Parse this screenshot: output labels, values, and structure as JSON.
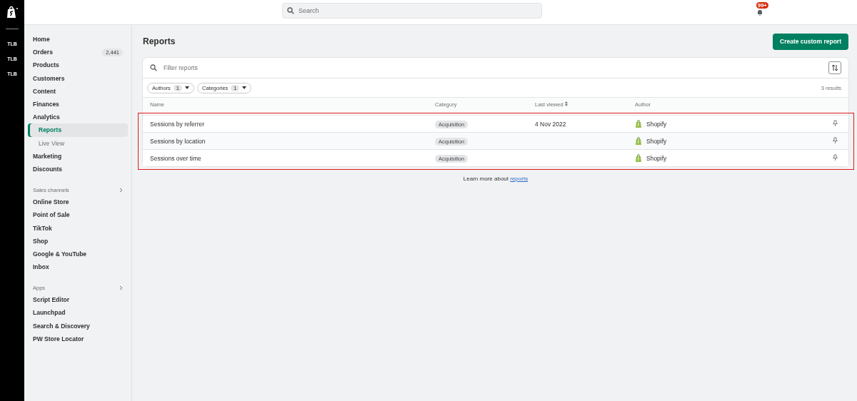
{
  "rail": {
    "items": [
      {
        "label": "TLB",
        "selected": false
      },
      {
        "label": "TLB",
        "selected": false
      },
      {
        "label": "TLB",
        "selected": false
      }
    ]
  },
  "top_bar": {
    "search": {
      "placeholder": "Search"
    },
    "notifications": {
      "badge": "99+"
    }
  },
  "sidebar": {
    "groups": [
      {
        "items": [
          {
            "label": "Home",
            "selected": false
          },
          {
            "label": "Orders",
            "badge": "2,441",
            "selected": false
          },
          {
            "label": "Products",
            "selected": false
          },
          {
            "label": "Customers",
            "selected": false
          },
          {
            "label": "Content",
            "selected": false
          },
          {
            "label": "Finances",
            "selected": false
          },
          {
            "label": "Analytics",
            "selected": false,
            "children": [
              {
                "label": "Reports",
                "selected": true
              },
              {
                "label": "Live View",
                "selected": false
              }
            ]
          },
          {
            "label": "Marketing",
            "selected": false
          },
          {
            "label": "Discounts",
            "selected": false
          }
        ]
      },
      {
        "heading": "Sales channels",
        "items": [
          {
            "label": "Online Store",
            "selected": false
          },
          {
            "label": "Point of Sale",
            "selected": false
          },
          {
            "label": "TikTok",
            "selected": false
          },
          {
            "label": "Shop",
            "selected": false
          },
          {
            "label": "Google & YouTube",
            "selected": false
          },
          {
            "label": "Inbox",
            "selected": false
          }
        ]
      },
      {
        "heading": "Apps",
        "items": [
          {
            "label": "Script Editor",
            "selected": false
          },
          {
            "label": "Launchpad",
            "selected": false
          },
          {
            "label": "Search & Discovery",
            "selected": false
          },
          {
            "label": "PW Store Locator",
            "selected": false
          }
        ]
      }
    ]
  },
  "page": {
    "title": "Reports",
    "primary_action": "Create custom report",
    "filter": {
      "placeholder": "Filter reports"
    },
    "chips": [
      {
        "label": "Authors",
        "count": "1"
      },
      {
        "label": "Categories",
        "count": "1"
      }
    ],
    "results": "3 results",
    "table": {
      "highlighted": true,
      "columns": [
        "Name",
        "Category",
        "Last viewed",
        "Author"
      ],
      "rows": [
        {
          "name": "Sessions by referrer",
          "category": "Acquisition",
          "last_viewed": "4 Nov 2022",
          "author": "Shopify"
        },
        {
          "name": "Sessions by location",
          "category": "Acquisition",
          "author": "Shopify"
        },
        {
          "name": "Sessions over time",
          "category": "Acquisition",
          "author": "Shopify"
        }
      ]
    },
    "footer": {
      "text": "Learn more about",
      "link": "reports"
    }
  }
}
